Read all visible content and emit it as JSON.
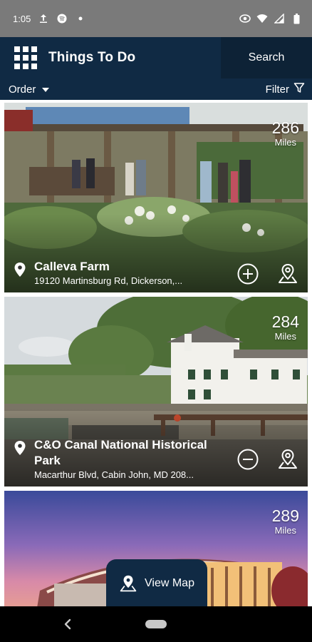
{
  "status_bar": {
    "time": "1:05"
  },
  "header": {
    "title": "Things To Do",
    "search_label": "Search"
  },
  "toolbar": {
    "order_label": "Order",
    "filter_label": "Filter"
  },
  "places": [
    {
      "distance": "286",
      "unit": "Miles",
      "name": "Calleva Farm",
      "address": "19120 Martinsburg Rd, Dickerson,...",
      "action_icon": "plus-circle-icon"
    },
    {
      "distance": "284",
      "unit": "Miles",
      "name": "C&O Canal National Historical",
      "name_line2": "Park",
      "address": "Macarthur Blvd, Cabin John, MD 208...",
      "action_icon": "minus-circle-icon"
    },
    {
      "distance": "289",
      "unit": "Miles"
    }
  ],
  "map_button": {
    "label": "View Map"
  },
  "colors": {
    "brand_navy": "#102a44",
    "status_bar": "#7a7a7a"
  }
}
